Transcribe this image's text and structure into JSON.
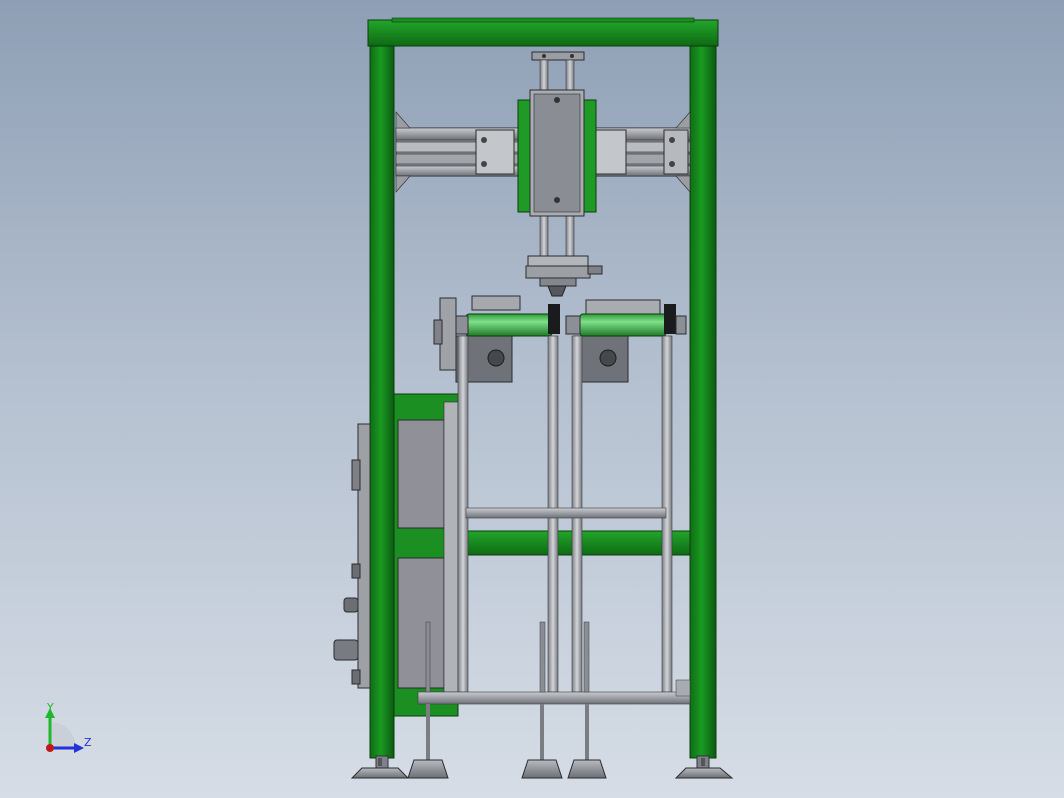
{
  "triad": {
    "y_label": "Y",
    "z_label": "Z",
    "y_color": "#1eb82a",
    "z_color": "#2232d8",
    "origin_color": "#c01818"
  },
  "colors": {
    "frame_green": "#168a1d",
    "frame_green_dark": "#0b5c10",
    "roller_green": "#3fc24c",
    "steel": "#a6a8ad",
    "steel_dark": "#6f7277",
    "panel_grey": "#8f9098",
    "outline": "#202225"
  }
}
